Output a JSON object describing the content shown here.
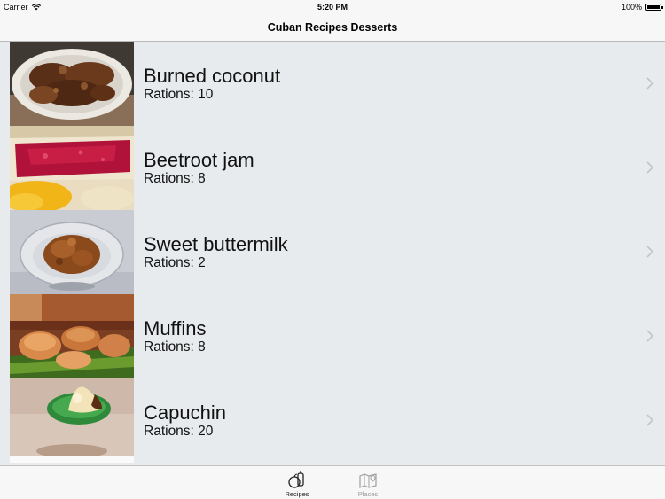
{
  "status_bar": {
    "carrier": "Carrier",
    "time": "5:20 PM",
    "battery": "100%",
    "battery_level": 1.0
  },
  "nav": {
    "title": "Cuban Recipes Desserts"
  },
  "recipes": [
    {
      "title": "Burned coconut",
      "rations": "Rations: 10"
    },
    {
      "title": "Beetroot jam",
      "rations": "Rations: 8"
    },
    {
      "title": "Sweet buttermilk",
      "rations": "Rations: 2"
    },
    {
      "title": "Muffins",
      "rations": "Rations: 8"
    },
    {
      "title": "Capuchin",
      "rations": "Rations: 20"
    }
  ],
  "tabs": {
    "recipes_label": "Recipes",
    "places_label": "Places",
    "active": "Recipes"
  },
  "icons": {
    "recipes_tab": "fruit-basket-icon",
    "places_tab": "map-icon",
    "row_disclosure": "chevron-right-icon"
  }
}
